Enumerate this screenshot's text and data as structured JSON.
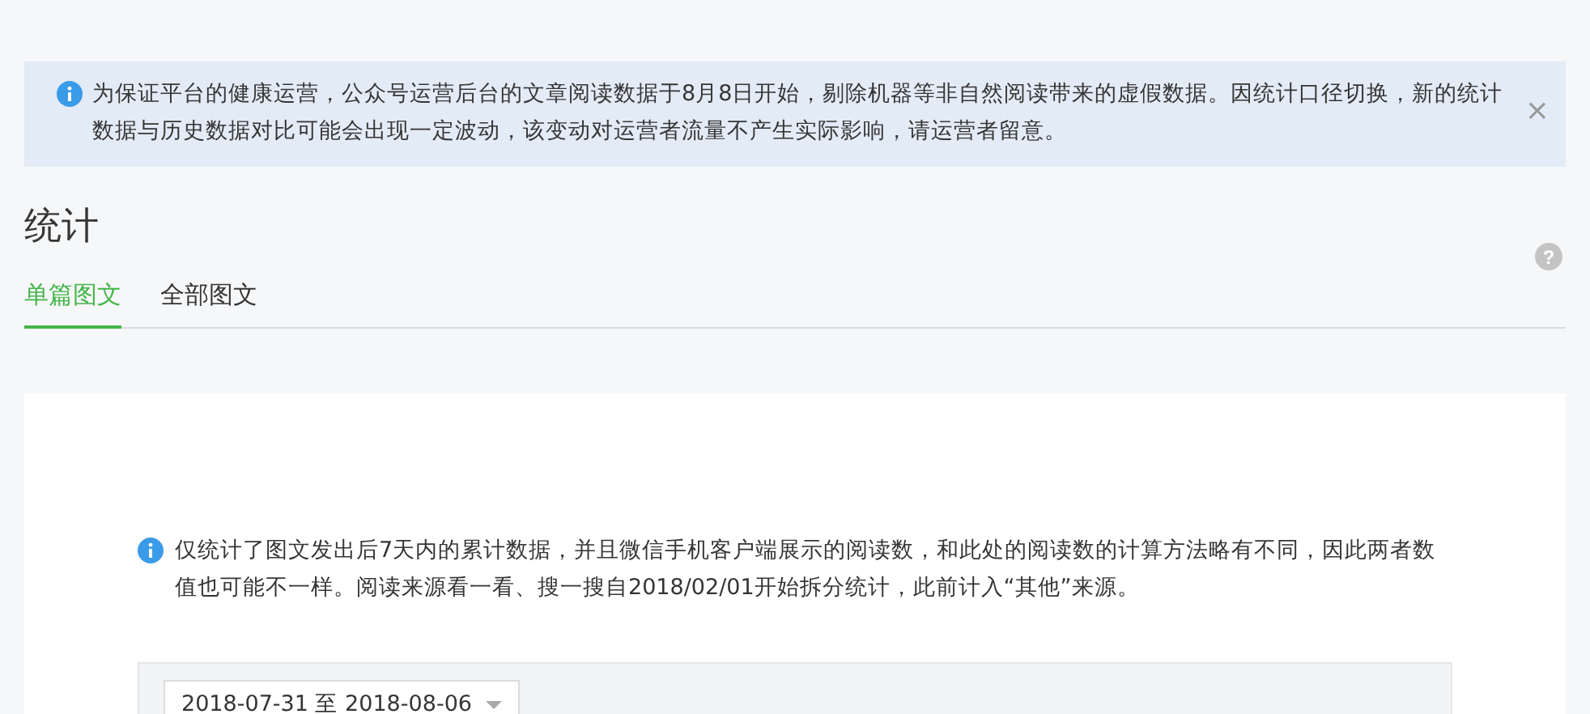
{
  "notice": {
    "text": "为保证平台的健康运营，公众号运营后台的文章阅读数据于8月8日开始，剔除机器等非自然阅读带来的虚假数据。因统计口径切换，新的统计数据与历史数据对比可能会出现一定波动，该变动对运营者流量不产生实际影响，请运营者留意。",
    "close": "×"
  },
  "title": "统计",
  "help": "?",
  "tabs": [
    {
      "label": "单篇图文",
      "selected": true
    },
    {
      "label": "全部图文",
      "selected": false
    }
  ],
  "card": {
    "info": "仅统计了图文发出后7天内的累计数据，并且微信手机客户端展示的阅读数，和此处的阅读数的计算方法略有不同，因此两者数值也可能不一样。阅读来源看一看、搜一搜自2018/02/01开始拆分统计，此前计入“其他”来源。",
    "date_range": "2018-07-31 至 2018-08-06"
  }
}
